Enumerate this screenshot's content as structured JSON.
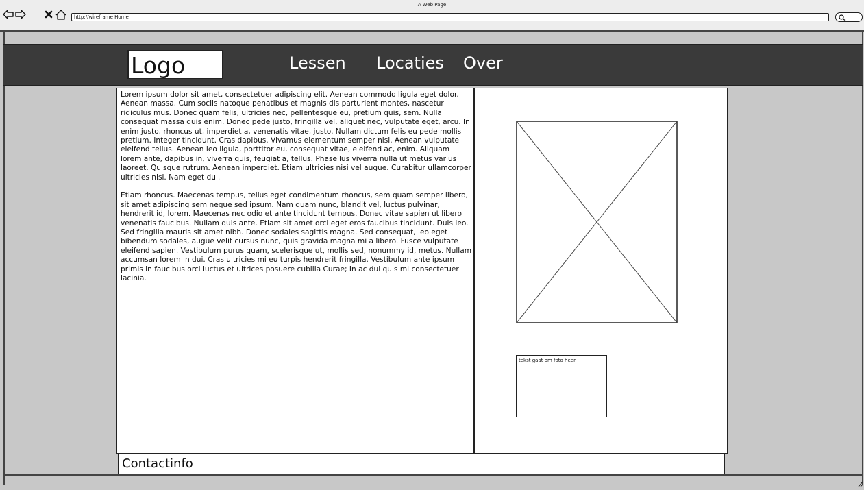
{
  "browser": {
    "window_title": "A Web Page",
    "url": "http://wireframe Home",
    "icons": [
      "back-arrow-icon",
      "forward-arrow-icon",
      "close-icon",
      "home-icon",
      "search-icon"
    ]
  },
  "header": {
    "logo": "Logo",
    "nav": [
      "Lessen",
      "Locaties",
      "Over"
    ]
  },
  "main": {
    "paragraphs": [
      "Lorem ipsum dolor sit amet, consectetuer adipiscing elit. Aenean commodo ligula eget dolor. Aenean massa. Cum sociis natoque penatibus et magnis dis parturient montes, nascetur ridiculus mus. Donec quam felis, ultricies nec, pellentesque eu, pretium quis, sem. Nulla consequat massa quis enim. Donec pede justo, fringilla vel, aliquet nec, vulputate eget, arcu. In enim justo, rhoncus ut, imperdiet a, venenatis vitae, justo. Nullam dictum felis eu pede mollis pretium. Integer tincidunt. Cras dapibus. Vivamus elementum semper nisi. Aenean vulputate eleifend tellus. Aenean leo ligula, porttitor eu, consequat vitae, eleifend ac, enim. Aliquam lorem ante, dapibus in, viverra quis, feugiat a, tellus. Phasellus viverra nulla ut metus varius laoreet. Quisque rutrum. Aenean imperdiet. Etiam ultricies nisi vel augue. Curabitur ullamcorper ultricies nisi. Nam eget dui.",
      "Etiam rhoncus. Maecenas tempus, tellus eget condimentum rhoncus, sem quam semper libero, sit amet adipiscing sem neque sed ipsum. Nam quam nunc, blandit vel, luctus pulvinar, hendrerit id, lorem. Maecenas nec odio et ante tincidunt tempus. Donec vitae sapien ut libero venenatis faucibus. Nullam quis ante. Etiam sit amet orci eget eros faucibus tincidunt. Duis leo. Sed fringilla mauris sit amet nibh. Donec sodales sagittis magna. Sed consequat, leo eget bibendum sodales, augue velit cursus nunc, quis gravida magna mi a libero. Fusce vulputate eleifend sapien. Vestibulum purus quam, scelerisque ut, mollis sed, nonummy id, metus. Nullam accumsan lorem in dui. Cras ultricies mi eu turpis hendrerit fringilla. Vestibulum ante ipsum primis in faucibus orci luctus et ultrices posuere cubilia Curae; In ac dui quis mi consectetuer lacinia."
    ]
  },
  "sidebar": {
    "caption": "tekst gaat om foto heen"
  },
  "footer": {
    "contact": "Contactinfo"
  },
  "colors": {
    "header_bg": "#3a3a3a",
    "page_bg": "#c8c8c8",
    "panel_bg": "#ffffff"
  }
}
